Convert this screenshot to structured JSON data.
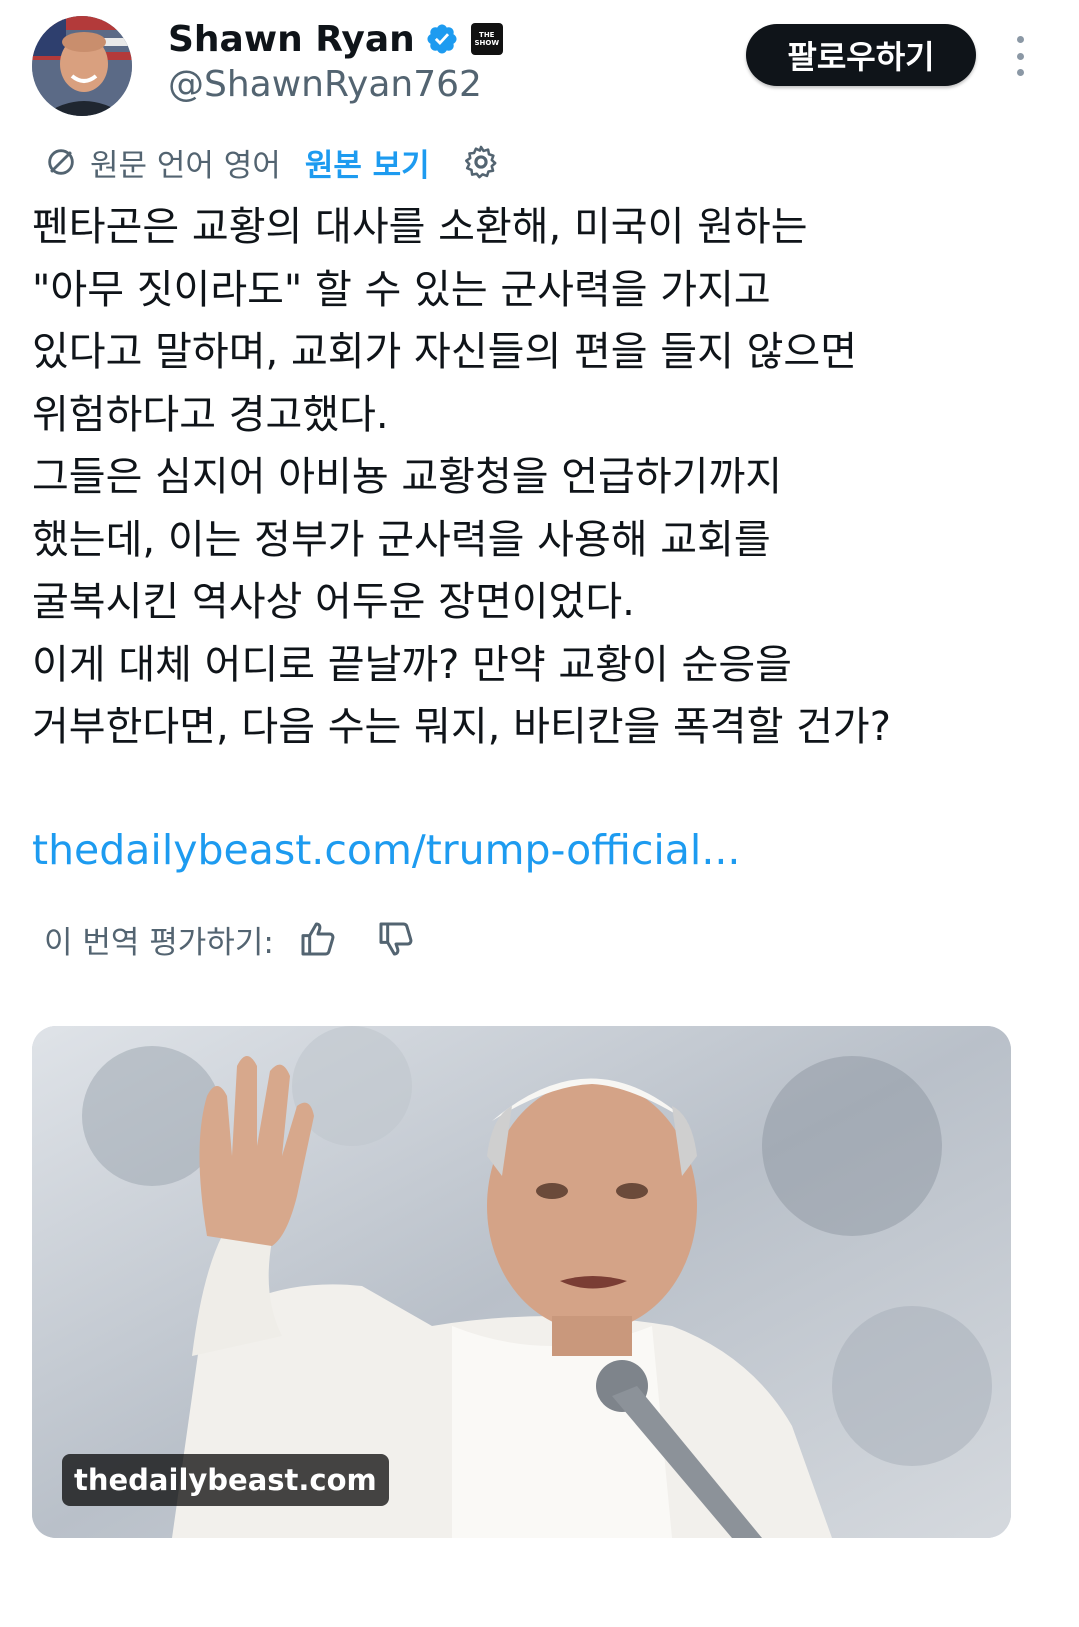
{
  "author": {
    "display_name": "Shawn Ryan",
    "handle": "@ShawnRyan762",
    "affiliate_badge_text": "THE SHOW"
  },
  "actions": {
    "follow_label": "팔로우하기"
  },
  "translation": {
    "source_language_label": "원문 언어 영어",
    "show_original_label": "원본 보기"
  },
  "tweet": {
    "text": "펜타곤은 교황의 대사를 소환해, 미국이 원하는\n\"아무 짓이라도\" 할 수 있는 군사력을 가지고\n있다고 말하며, 교회가 자신들의 편을 들지 않으면\n위험하다고 경고했다.\n그들은 심지어 아비뇽 교황청을 언급하기까지\n했는데, 이는 정부가 군사력을 사용해 교회를\n굴복시킨 역사상 어두운 장면이었다.\n이게 대체 어디로 끝날까? 만약 교황이 순응을\n거부한다면, 다음 수는 뭐지, 바티칸을 폭격할 건가?",
    "link_text": "thedailybeast.com/trump-official..."
  },
  "rating": {
    "label": "이 번역 평가하기:"
  },
  "media": {
    "domain_label": "thedailybeast.com"
  },
  "colors": {
    "accent": "#1d9bf0",
    "text_primary": "#0f1419",
    "text_secondary": "#536471",
    "button_bg": "#0f1419"
  },
  "icons": {
    "verified": "verified-badge-icon",
    "more": "more-vertical-icon",
    "translate": "translate-icon",
    "settings": "gear-icon",
    "thumbs_up": "thumbs-up-icon",
    "thumbs_down": "thumbs-down-icon"
  }
}
